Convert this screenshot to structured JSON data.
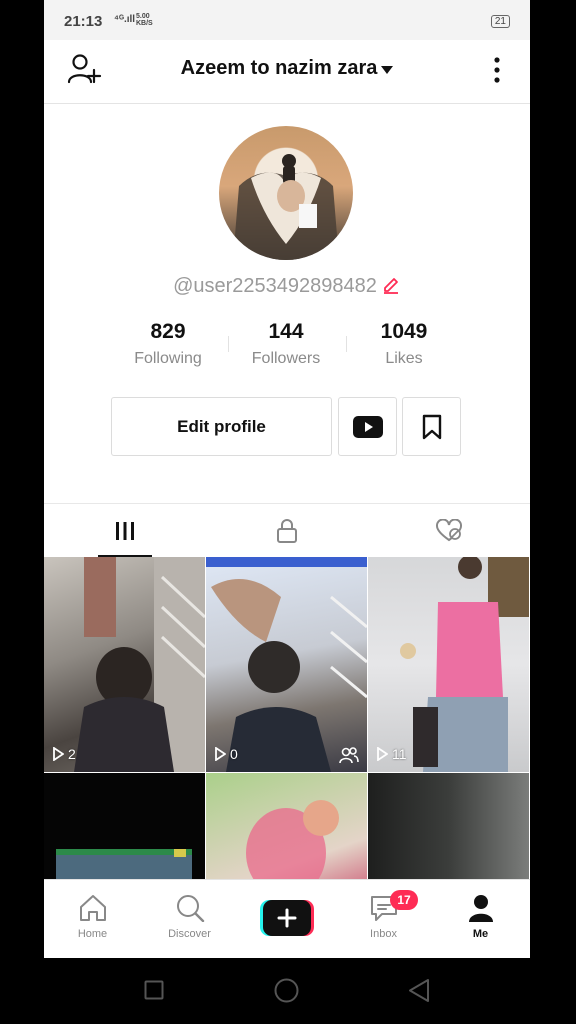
{
  "status_bar": {
    "time": "21:13",
    "signal": "⁴ᴳ.ıll",
    "net_speed": "5.00",
    "net_unit": "KB/S",
    "battery": "21"
  },
  "header": {
    "title": "Azeem  to nazim zara"
  },
  "profile": {
    "username": "@user2253492898482",
    "stats": [
      {
        "value": "829",
        "label": "Following"
      },
      {
        "value": "144",
        "label": "Followers"
      },
      {
        "value": "1049",
        "label": "Likes"
      }
    ],
    "edit_profile_label": "Edit profile"
  },
  "videos": [
    {
      "views": "2"
    },
    {
      "views": "0"
    },
    {
      "views": "11"
    }
  ],
  "bottom_nav": {
    "home": "Home",
    "discover": "Discover",
    "inbox": "Inbox",
    "inbox_badge": "17",
    "me": "Me"
  },
  "colors": {
    "accent": "#fe2c55",
    "cyan": "#25f4ee"
  }
}
